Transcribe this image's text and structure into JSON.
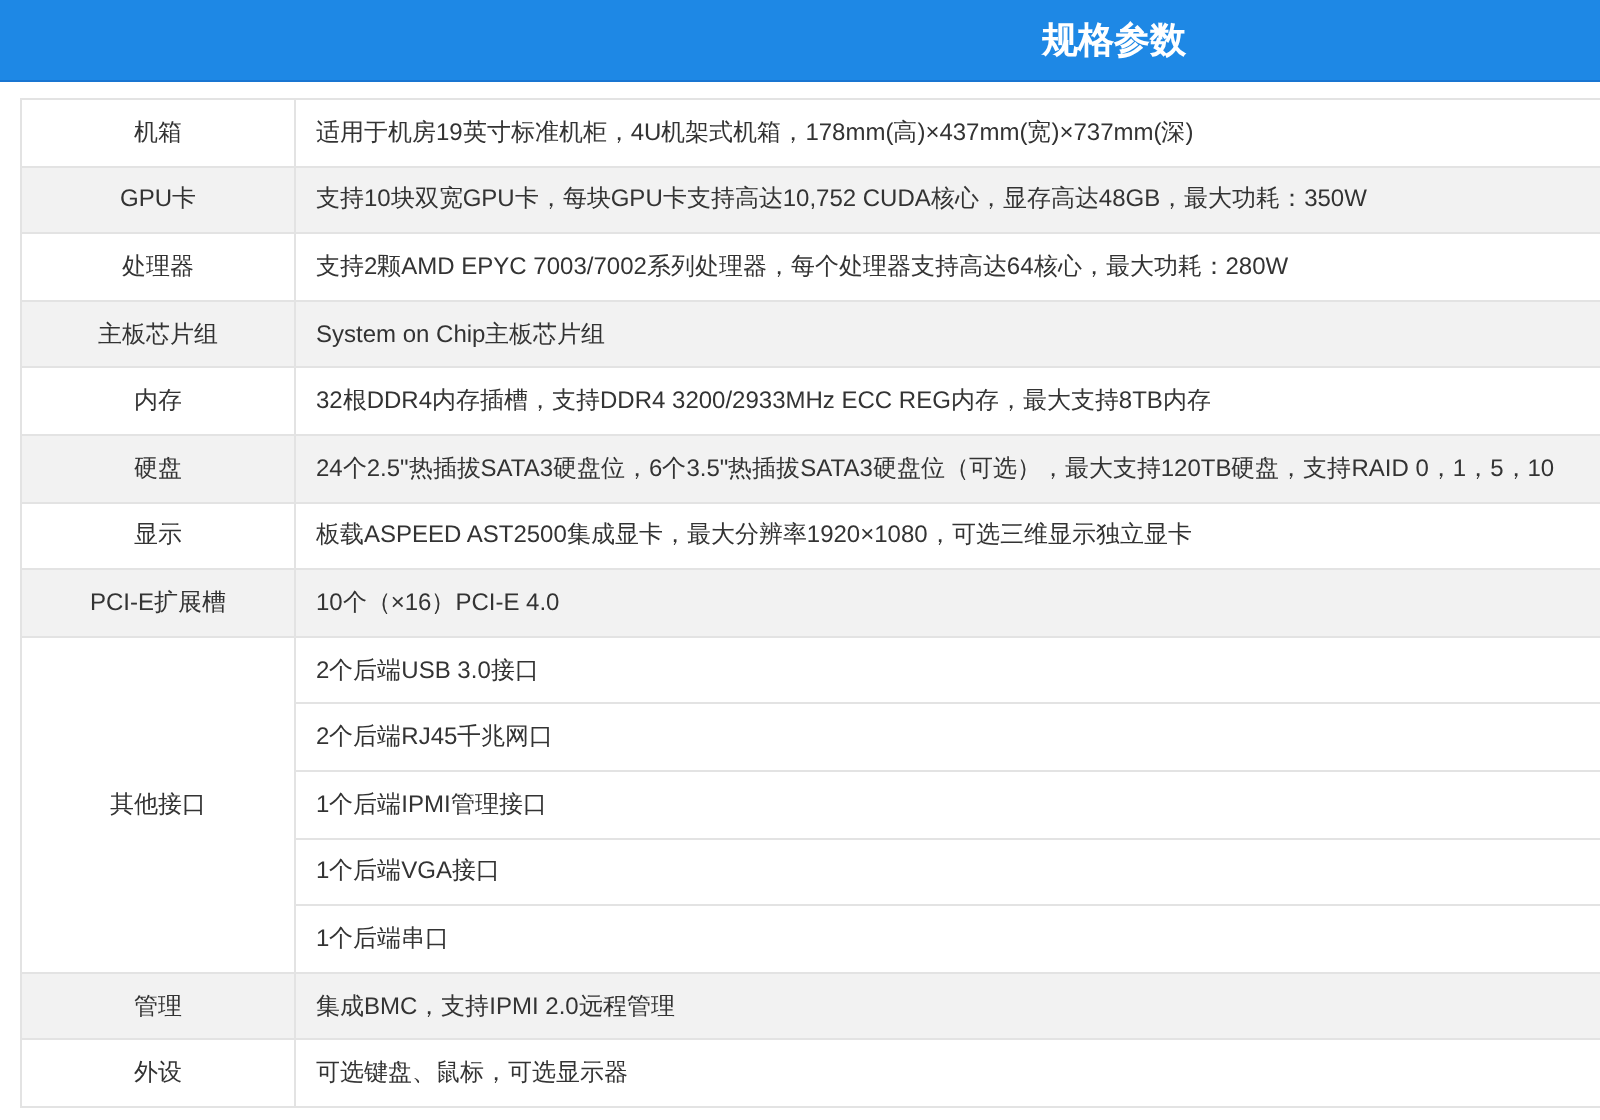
{
  "header": {
    "title": "规格参数"
  },
  "specs": [
    {
      "label": "机箱",
      "values": [
        "适用于机房19英寸标准机柜，4U机架式机箱，178mm(高)×437mm(宽)×737mm(深)"
      ]
    },
    {
      "label": "GPU卡",
      "values": [
        "支持10块双宽GPU卡，每块GPU卡支持高达10,752 CUDA核心，显存高达48GB，最大功耗：350W"
      ]
    },
    {
      "label": "处理器",
      "values": [
        "支持2颗AMD EPYC 7003/7002系列处理器，每个处理器支持高达64核心，最大功耗：280W"
      ]
    },
    {
      "label": "主板芯片组",
      "values": [
        "System on Chip主板芯片组"
      ]
    },
    {
      "label": "内存",
      "values": [
        "32根DDR4内存插槽，支持DDR4 3200/2933MHz ECC REG内存，最大支持8TB内存"
      ]
    },
    {
      "label": "硬盘",
      "values": [
        "24个2.5\"热插拔SATA3硬盘位，6个3.5\"热插拔SATA3硬盘位（可选），最大支持120TB硬盘，支持RAID 0，1，5，10"
      ]
    },
    {
      "label": "显示",
      "values": [
        "板载ASPEED AST2500集成显卡，最大分辨率1920×1080，可选三维显示独立显卡"
      ]
    },
    {
      "label": "PCI-E扩展槽",
      "values": [
        "10个（×16）PCI-E 4.0"
      ]
    },
    {
      "label": "其他接口",
      "values": [
        "2个后端USB 3.0接口",
        "2个后端RJ45千兆网口",
        "1个后端IPMI管理接口",
        "1个后端VGA接口",
        "1个后端串口"
      ]
    },
    {
      "label": "管理",
      "values": [
        "集成BMC，支持IPMI 2.0远程管理"
      ]
    },
    {
      "label": "外设",
      "values": [
        "可选键盘、鼠标，可选显示器"
      ]
    }
  ]
}
